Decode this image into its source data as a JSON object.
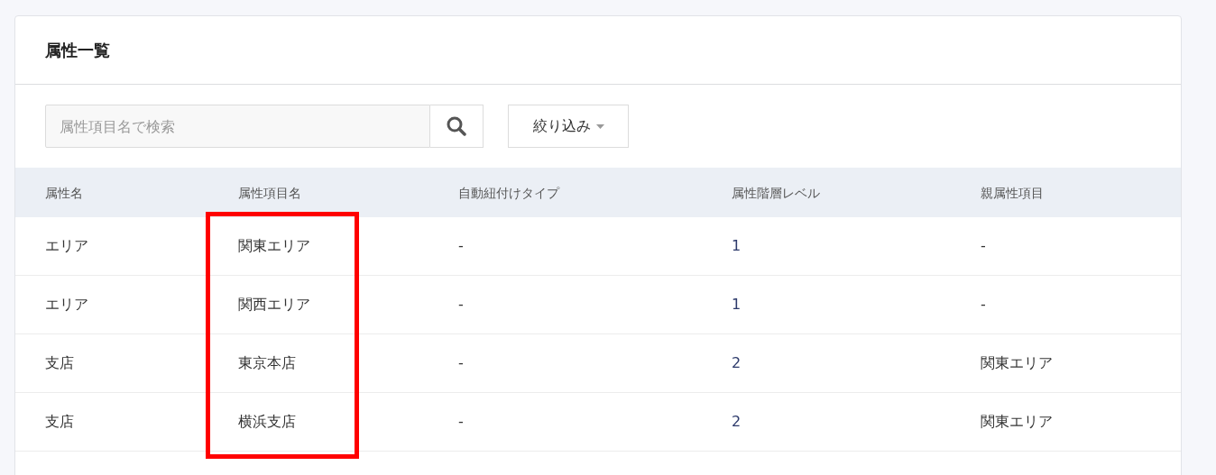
{
  "card": {
    "title": "属性一覧"
  },
  "search": {
    "placeholder": "属性項目名で検索"
  },
  "filter_button": {
    "label": "絞り込み"
  },
  "table": {
    "columns": [
      "属性名",
      "属性項目名",
      "自動紐付けタイプ",
      "属性階層レベル",
      "親属性項目"
    ],
    "rows": [
      [
        "エリア",
        "関東エリア",
        "-",
        "1",
        "-"
      ],
      [
        "エリア",
        "関西エリア",
        "-",
        "1",
        "-"
      ],
      [
        "支店",
        "東京本店",
        "-",
        "2",
        "関東エリア"
      ],
      [
        "支店",
        "横浜支店",
        "-",
        "2",
        "関東エリア"
      ]
    ]
  }
}
